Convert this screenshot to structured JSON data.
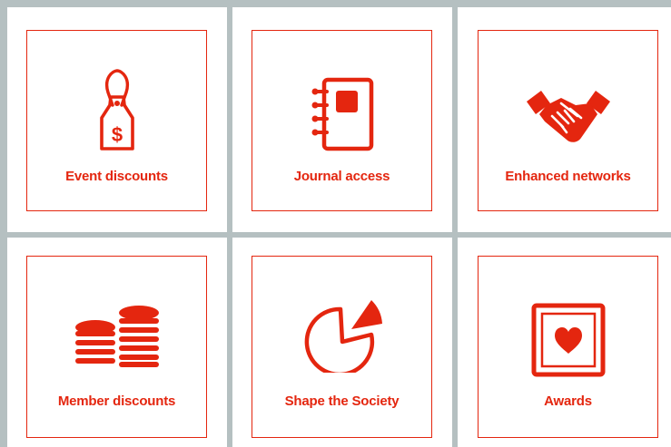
{
  "accent_color": "#e4260f",
  "background_color": "#b5c0c1",
  "benefits": [
    {
      "label": "Event discounts",
      "icon": "price-tag-icon"
    },
    {
      "label": "Journal access",
      "icon": "notebook-icon"
    },
    {
      "label": "Enhanced networks",
      "icon": "handshake-icon"
    },
    {
      "label": "Member discounts",
      "icon": "coin-stacks-icon"
    },
    {
      "label": "Shape the Society",
      "icon": "pie-chart-icon"
    },
    {
      "label": "Awards",
      "icon": "framed-heart-icon"
    }
  ]
}
